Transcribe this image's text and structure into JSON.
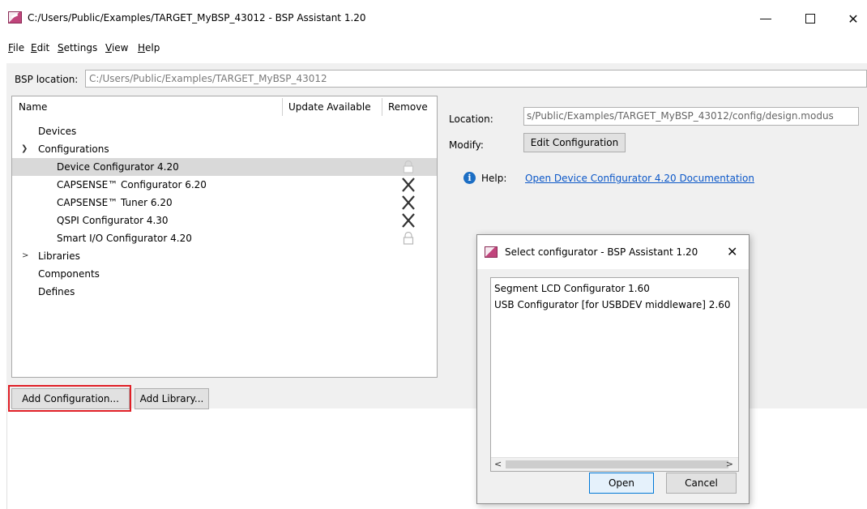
{
  "window": {
    "title": "C:/Users/Public/Examples/TARGET_MyBSP_43012 - BSP Assistant 1.20",
    "minimize_glyph": "",
    "close_glyph": "✕"
  },
  "menu": [
    {
      "label": "File",
      "accel": "F",
      "rest": "ile"
    },
    {
      "label": "Edit",
      "accel": "E",
      "rest": "dit"
    },
    {
      "label": "Settings",
      "accel": "S",
      "rest": "ettings"
    },
    {
      "label": "View",
      "accel": "V",
      "rest": "iew"
    },
    {
      "label": "Help",
      "accel": "H",
      "rest": "elp"
    }
  ],
  "bsp": {
    "label": "BSP location:",
    "value": "C:/Users/Public/Examples/TARGET_MyBSP_43012"
  },
  "tree": {
    "headers": {
      "name": "Name",
      "update": "Update Available",
      "remove": "Remove"
    },
    "rows": [
      {
        "label": "Devices",
        "level": 1,
        "icon": "none"
      },
      {
        "label": "Configurations",
        "level": 1,
        "expand": "expanded",
        "icon": "none"
      },
      {
        "label": "Device Configurator 4.20",
        "level": 2,
        "selected": true,
        "icon": "lock-icon"
      },
      {
        "label": "CAPSENSE™ Configurator 6.20",
        "level": 2,
        "icon": "remove-x-icon"
      },
      {
        "label": "CAPSENSE™ Tuner 6.20",
        "level": 2,
        "icon": "remove-x-icon"
      },
      {
        "label": "QSPI Configurator 4.30",
        "level": 2,
        "icon": "remove-x-icon"
      },
      {
        "label": "Smart I/O Configurator 4.20",
        "level": 2,
        "icon": "lock-icon"
      },
      {
        "label": "Libraries",
        "level": 1,
        "expand": "collapsed",
        "icon": "none"
      },
      {
        "label": "Components",
        "level": 1,
        "icon": "none"
      },
      {
        "label": "Defines",
        "level": 1,
        "icon": "none"
      }
    ]
  },
  "buttons": {
    "add_configuration": "Add Configuration...",
    "add_library": "Add Library..."
  },
  "details": {
    "location_label": "Location:",
    "location_value": "s/Public/Examples/TARGET_MyBSP_43012/config/design.modus",
    "modify_label": "Modify:",
    "edit_button": "Edit Configuration",
    "help_label": "Help:",
    "help_link": "Open Device Configurator 4.20 Documentation"
  },
  "dialog": {
    "title": "Select configurator - BSP Assistant 1.20",
    "close_glyph": "✕",
    "items": [
      "Segment LCD Configurator 1.60",
      "USB Configurator [for USBDEV middleware] 2.60"
    ],
    "scroll_left": "<",
    "scroll_right": ">",
    "open_button": "Open",
    "cancel_button": "Cancel"
  },
  "colors": {
    "highlight_border": "#e01f26",
    "link": "#0b57c8",
    "selected_row": "#d9d9d9",
    "info_icon": "#1c6ec4"
  }
}
